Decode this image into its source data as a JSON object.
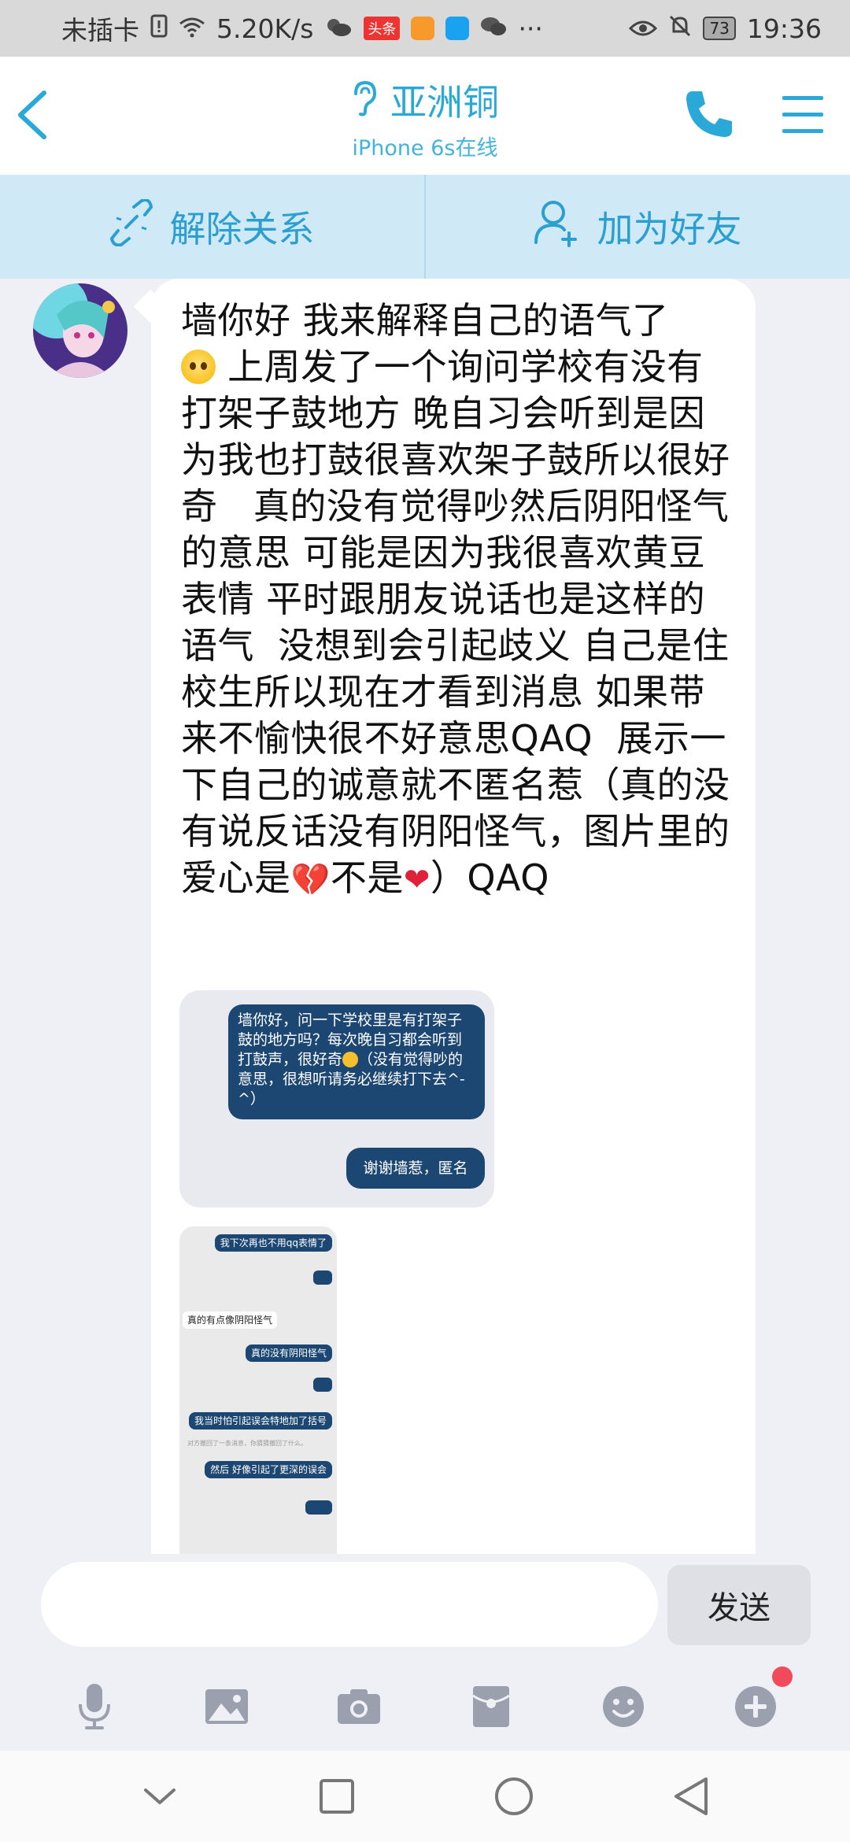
{
  "status_bar": {
    "carrier": "未插卡",
    "speed": "5.20K/s",
    "badge_toutiao": "头条",
    "more": "···",
    "battery": "73",
    "time": "19:36"
  },
  "header": {
    "title": "亚洲铜",
    "subtitle": "iPhone 6s在线"
  },
  "actions": {
    "unlink_label": "解除关系",
    "add_friend_label": "加为好友"
  },
  "message": {
    "part1": "墙你好 我来解释自己的语气了\n",
    "part2": " 上周发了一个询问学校有没有打架子鼓地方 晚自习会听到是因为我也打鼓很喜欢架子鼓所以很好奇   真的没有觉得吵然后阴阳怪气的意思 可能是因为我很喜欢黄豆表情 平时跟朋友说话也是这样的语气  没想到会引起歧义 自己是住校生所以现在才看到消息 如果带来不愉快很不好意思QAQ  展示一下自己的诚意就不匿名惹（真的没有说反话没有阴阳怪气，图片里的爱心是",
    "part3": "不是",
    "part4": "）QAQ"
  },
  "screenshot1": {
    "bubble1": "墙你好，问一下学校里是有打架子鼓的地方吗？每次晚自习都会听到打鼓声，很好奇",
    "bubble1_tail": "（没有觉得吵的意思，很想听请务必继续打下去^-^）",
    "bubble2": "谢谢墙惹，匿名"
  },
  "screenshot2": {
    "m1": "我下次再也不用qq表情了",
    "m2": "真的有点像阴阳怪气",
    "m3": "真的没有阴阳怪气",
    "m4": "我当时怕引起误会特地加了括号",
    "m5": "对方撤回了一条消息，你猜猜撤回了什么。",
    "m6": "然后 好像引起了更深的误会"
  },
  "input": {
    "placeholder": "",
    "send_label": "发送"
  },
  "colors": {
    "accent": "#2aa9d8",
    "action_bg": "#cfe9f7",
    "bubble_dark": "#1d4773"
  }
}
